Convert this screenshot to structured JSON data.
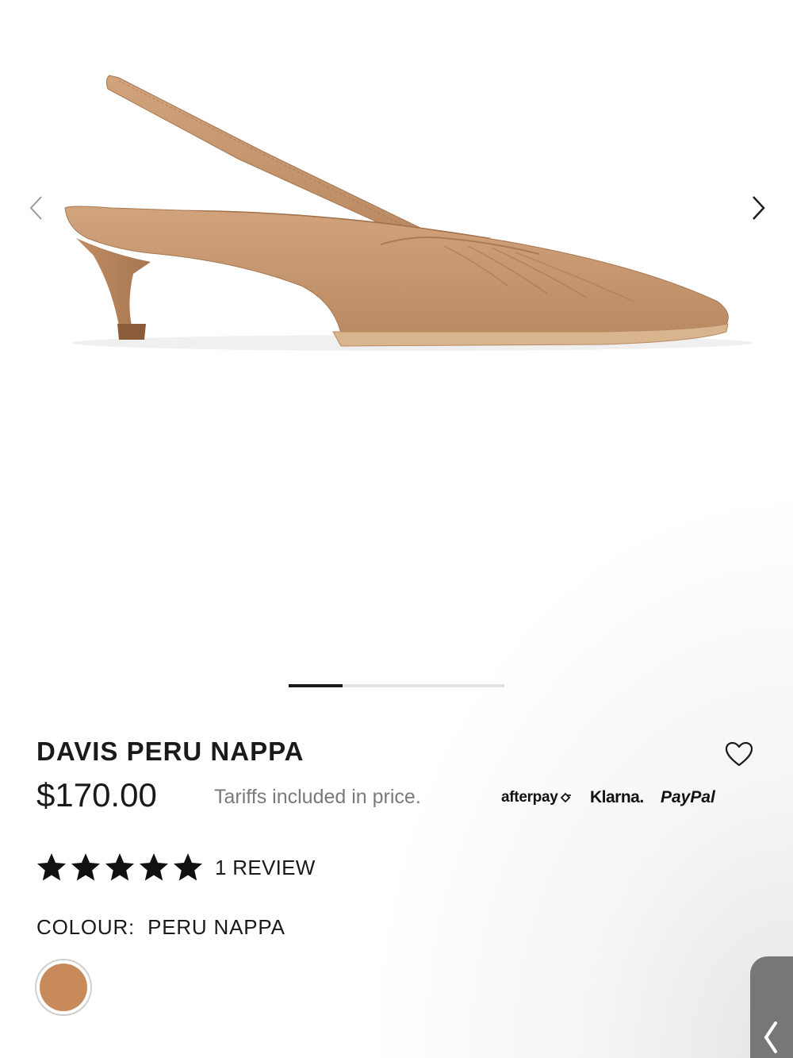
{
  "product": {
    "title": "DAVIS PERU NAPPA",
    "price": "$170.00",
    "tariff_note": "Tariffs included in price.",
    "wishlist_icon": "heart-outline-icon"
  },
  "gallery": {
    "prev_icon": "chevron-left-icon",
    "next_icon": "chevron-right-icon",
    "progress_fraction": 0.25
  },
  "payment_providers": {
    "afterpay": "afterpay",
    "klarna": "Klarna.",
    "paypal": "PayPal"
  },
  "rating": {
    "stars": 5,
    "max_stars": 5,
    "review_label": "1 REVIEW"
  },
  "colour": {
    "label": "COLOUR:",
    "value": "PERU NAPPA",
    "swatch_color": "#c88a5a"
  },
  "colors": {
    "leather": "#c79a74",
    "leather_dark": "#a87650",
    "text": "#1a1a1a",
    "muted": "#7a7a7a"
  }
}
